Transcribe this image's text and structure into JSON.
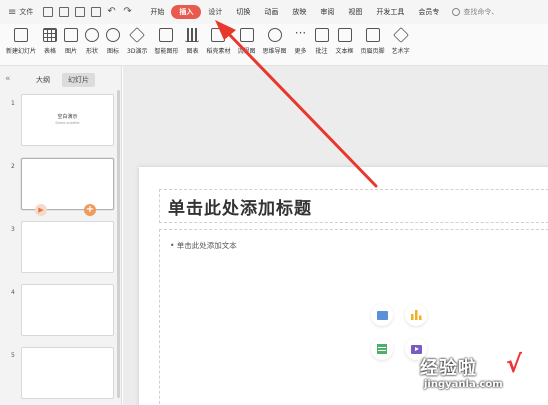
{
  "menubar": {
    "menu_icon": "≡",
    "file_label": "文件",
    "tabs": [
      "开始",
      "插入",
      "设计",
      "切换",
      "动画",
      "放映",
      "审阅",
      "视图",
      "开发工具",
      "会员专"
    ],
    "active_tab": "插入",
    "search_placeholder": "查找命令、"
  },
  "ribbon": {
    "buttons": [
      "新建幻灯片",
      "表格",
      "图片",
      "形状",
      "图标",
      "3D演示",
      "智能图形",
      "图表",
      "稻壳素材",
      "流程图",
      "思维导图",
      "更多",
      "批注",
      "文本框",
      "页眉页脚",
      "艺术字"
    ]
  },
  "leftpanel": {
    "collapse_icon": "«",
    "view_tabs": [
      "大纲",
      "幻灯片"
    ],
    "active_view": "幻灯片",
    "slides": [
      {
        "num": "1",
        "title": "空白演示",
        "subtitle": "Some subtitle"
      },
      {
        "num": "2"
      },
      {
        "num": "3"
      },
      {
        "num": "4"
      },
      {
        "num": "5"
      }
    ]
  },
  "slide": {
    "title_placeholder": "单击此处添加标题",
    "body_placeholder": "• 单击此处添加文本"
  },
  "watermark": {
    "text": "经验啦",
    "check": "√",
    "url": "jingyanla.com"
  },
  "colors": {
    "active_tab": "#e85a4f",
    "arrow": "#e8372c"
  }
}
